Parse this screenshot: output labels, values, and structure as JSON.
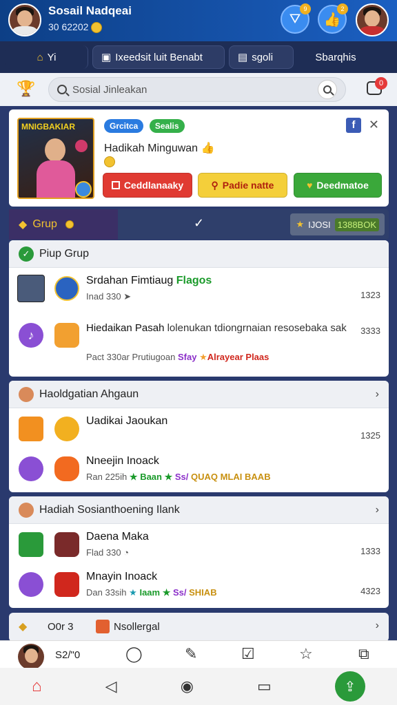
{
  "header": {
    "name": "Sosail Nadqeai",
    "sub": "30 62202",
    "badge_a": "9",
    "badge_b": "2"
  },
  "tabs": [
    {
      "icon": "home-icon",
      "label": "Yi"
    },
    {
      "icon": "image-icon",
      "label": "Ixeedsit luit Benabt"
    },
    {
      "icon": "folder-icon",
      "label": "sgoli"
    },
    {
      "label": "Sbarqhis"
    }
  ],
  "search": {
    "placeholder": "Sosial Jinleakan",
    "notif_count": "0"
  },
  "promo": {
    "poster_title": "MNIGBAKIAR",
    "chip1": "Grcitca",
    "chip2": "Sealis",
    "title": "Hadikah Minguwan",
    "btn_red": "Ceddlanaaky",
    "btn_yellow": "Padie natte",
    "btn_green": "Deedmatoe"
  },
  "group_bar": {
    "label": "Grup",
    "count_label": "IJOSI",
    "count_value": "1388BOK"
  },
  "section1": {
    "header": "Piup Grup",
    "rows": [
      {
        "title": "Srdahan Fimtiaug",
        "title_tag": "Flagos",
        "meta": "Inad 330",
        "num": "1323"
      },
      {
        "title": "Hiedaikan Pasah",
        "title_rest": "lolenukan tdiongrnaian resosebaka sak",
        "meta": "Pact 330ar Prutiugoan",
        "tag1": "Sfay",
        "tag2": "Alrayear Plaas",
        "num": "3333"
      }
    ]
  },
  "section2": {
    "header": "Haoldgatian Ahgaun",
    "rows": [
      {
        "title": "Uadikai Jaoukan",
        "num": "1325"
      },
      {
        "title": "Nneejin Inoack",
        "meta": "Ran 225ih",
        "tag1": "Baan",
        "tag2": "Ss/",
        "tag3": "QUAQ MLAI BAAB"
      }
    ]
  },
  "section3": {
    "header": "Hadiah Sosianthoening Ilank",
    "rows": [
      {
        "title": "Daena Maka",
        "meta": "Flad 330",
        "num": "1333"
      },
      {
        "title": "Mnayin Inoack",
        "meta": "Dan 33sih",
        "tag1": "Iaam",
        "tag2": "Ss/",
        "tag3": "SHIAB",
        "num": "4323"
      }
    ]
  },
  "section4": {
    "label_a": "O0r 3",
    "label_b": "Nsollergal"
  },
  "bottom": {
    "counter": "S2/\"0"
  }
}
